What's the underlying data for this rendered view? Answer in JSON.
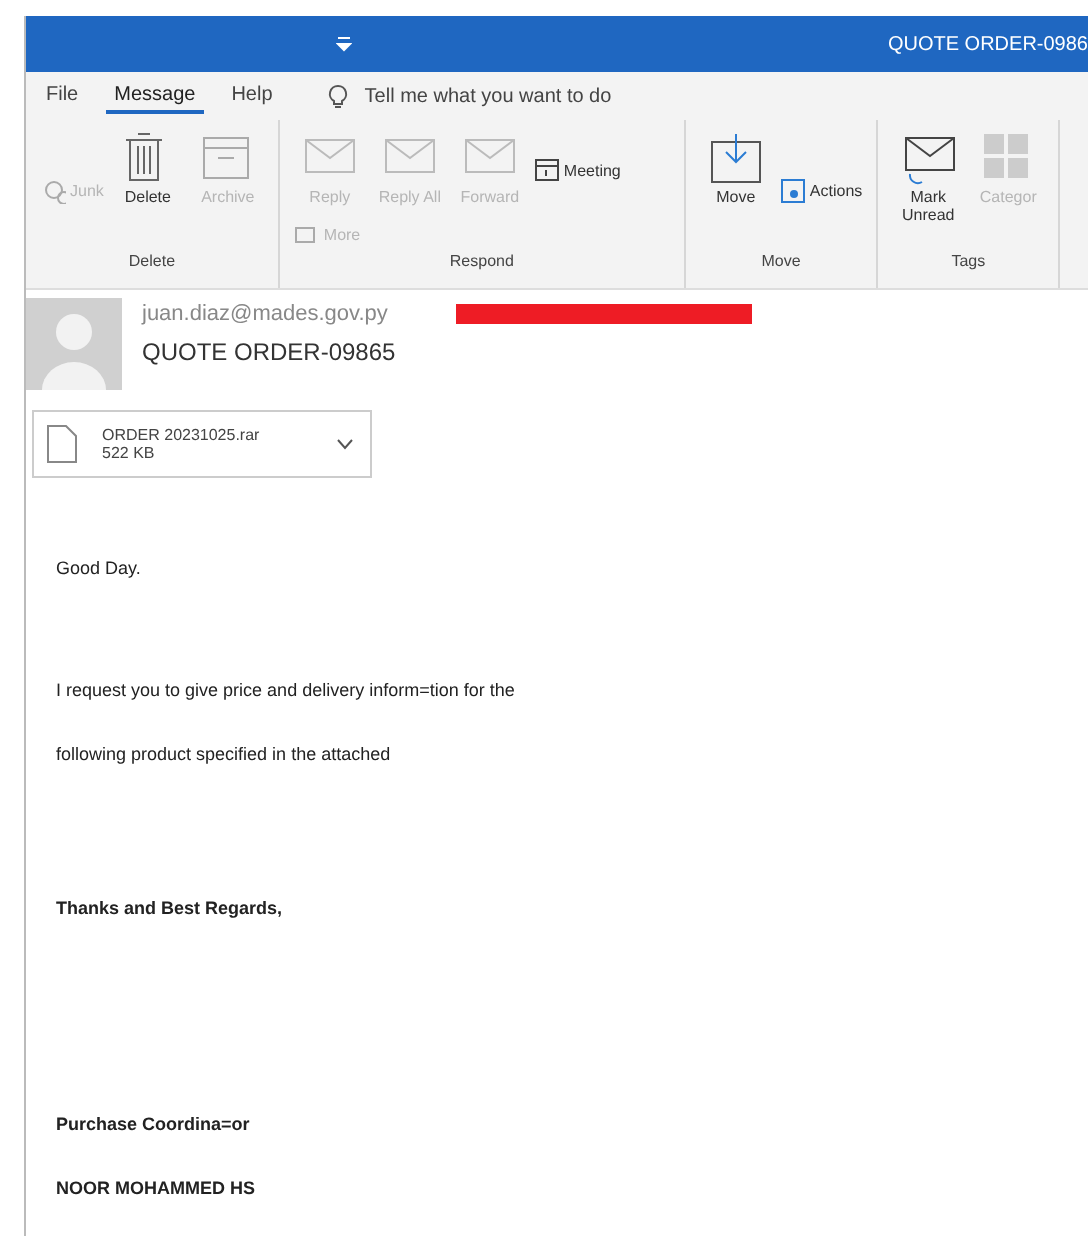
{
  "window": {
    "title": "QUOTE ORDER-0986"
  },
  "tabs": [
    {
      "label": "File",
      "selected": false
    },
    {
      "label": "Message",
      "selected": true
    },
    {
      "label": "Help",
      "selected": false
    }
  ],
  "tell_me": {
    "placeholder": "Tell me what you want to do"
  },
  "ribbon_groups": [
    {
      "label": "Delete",
      "buttons": [
        {
          "label": "Junk",
          "kind": "junk",
          "disabled": true
        },
        {
          "label": "Delete",
          "kind": "delete",
          "disabled": false
        },
        {
          "label": "Archive",
          "kind": "archive",
          "disabled": true
        }
      ]
    },
    {
      "label": "Respond",
      "buttons": [
        {
          "label": "Reply",
          "kind": "reply",
          "disabled": true
        },
        {
          "label": "Reply All",
          "kind": "reply",
          "disabled": true
        },
        {
          "label": "Forward",
          "kind": "reply",
          "disabled": true
        },
        {
          "label": "Meeting",
          "kind": "meeting",
          "disabled": false
        },
        {
          "label": "More",
          "kind": "more",
          "disabled": true
        }
      ]
    },
    {
      "label": "Move",
      "buttons": [
        {
          "label": "Move",
          "kind": "move",
          "disabled": false
        },
        {
          "label": "Actions",
          "kind": "actions",
          "disabled": false
        }
      ]
    },
    {
      "label": "Tags",
      "buttons": [
        {
          "label": "Mark Unread",
          "kind": "mark",
          "disabled": false
        },
        {
          "label": "Categor",
          "kind": "categorize",
          "disabled": true
        }
      ]
    }
  ],
  "message": {
    "sender": "juan.diaz@mades.gov.py",
    "subject": "QUOTE ORDER-09865",
    "attachment": {
      "name": "ORDER 20231025.rar",
      "size": "522 KB"
    },
    "paragraphs": [
      {
        "lines": [
          "Good Day."
        ],
        "bold": false
      },
      {
        "lines": [
          "I request you to give price and delivery inform=tion for the",
          "following product specified in the attached"
        ],
        "bold": false
      },
      {
        "lines": [
          "Thanks and Best Regards,"
        ],
        "bold": true
      },
      {
        "lines": [
          "Purchase Coordina=or",
          "NOOR MOHAMMED HS"
        ],
        "bold": true
      }
    ]
  }
}
